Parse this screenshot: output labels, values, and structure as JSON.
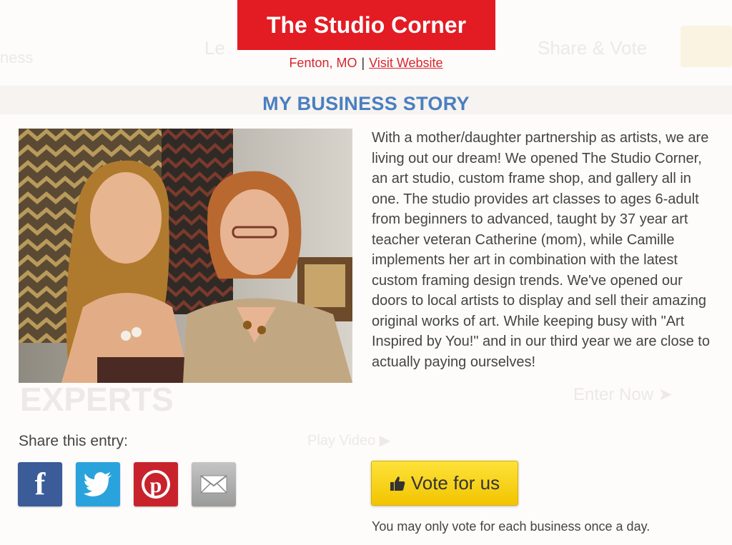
{
  "header": {
    "business_name": "The Studio Corner",
    "location": "Fenton, MO",
    "separator": "|",
    "website_link": "Visit Website"
  },
  "story": {
    "heading": "MY BUSINESS STORY",
    "photo_icon": "photo-of-two-women-in-frame-shop",
    "text": "With a mother/daughter partnership as artists, we are living out our dream! We opened The Studio Corner, an art studio, custom frame shop, and gallery all in one. The studio provides art classes to ages 6-adult from beginners to advanced, taught by 37 year art teacher veteran Catherine (mom), while Camille implements her art in combination with the latest custom framing design trends. We've opened our doors to local artists to display and sell their amazing original works of art. While keeping busy with \"Art Inspired by You!\" and in our third year we are close to actually paying ourselves!"
  },
  "share": {
    "label": "Share this entry:",
    "buttons": [
      {
        "name": "facebook",
        "icon": "facebook-icon",
        "color": "#3b5b99"
      },
      {
        "name": "twitter",
        "icon": "twitter-icon",
        "color": "#2aa3dd"
      },
      {
        "name": "pinterest",
        "icon": "pinterest-icon",
        "color": "#c8232c"
      },
      {
        "name": "email",
        "icon": "email-icon",
        "color": "#a8a8a8"
      }
    ]
  },
  "vote": {
    "button_label": "Vote for us",
    "button_icon": "thumbs-up-icon",
    "note": "You may only vote for each business once a day."
  },
  "colors": {
    "brand_red": "#e31b23",
    "heading_blue": "#4a7fc0",
    "vote_yellow": "#f7d21a"
  }
}
